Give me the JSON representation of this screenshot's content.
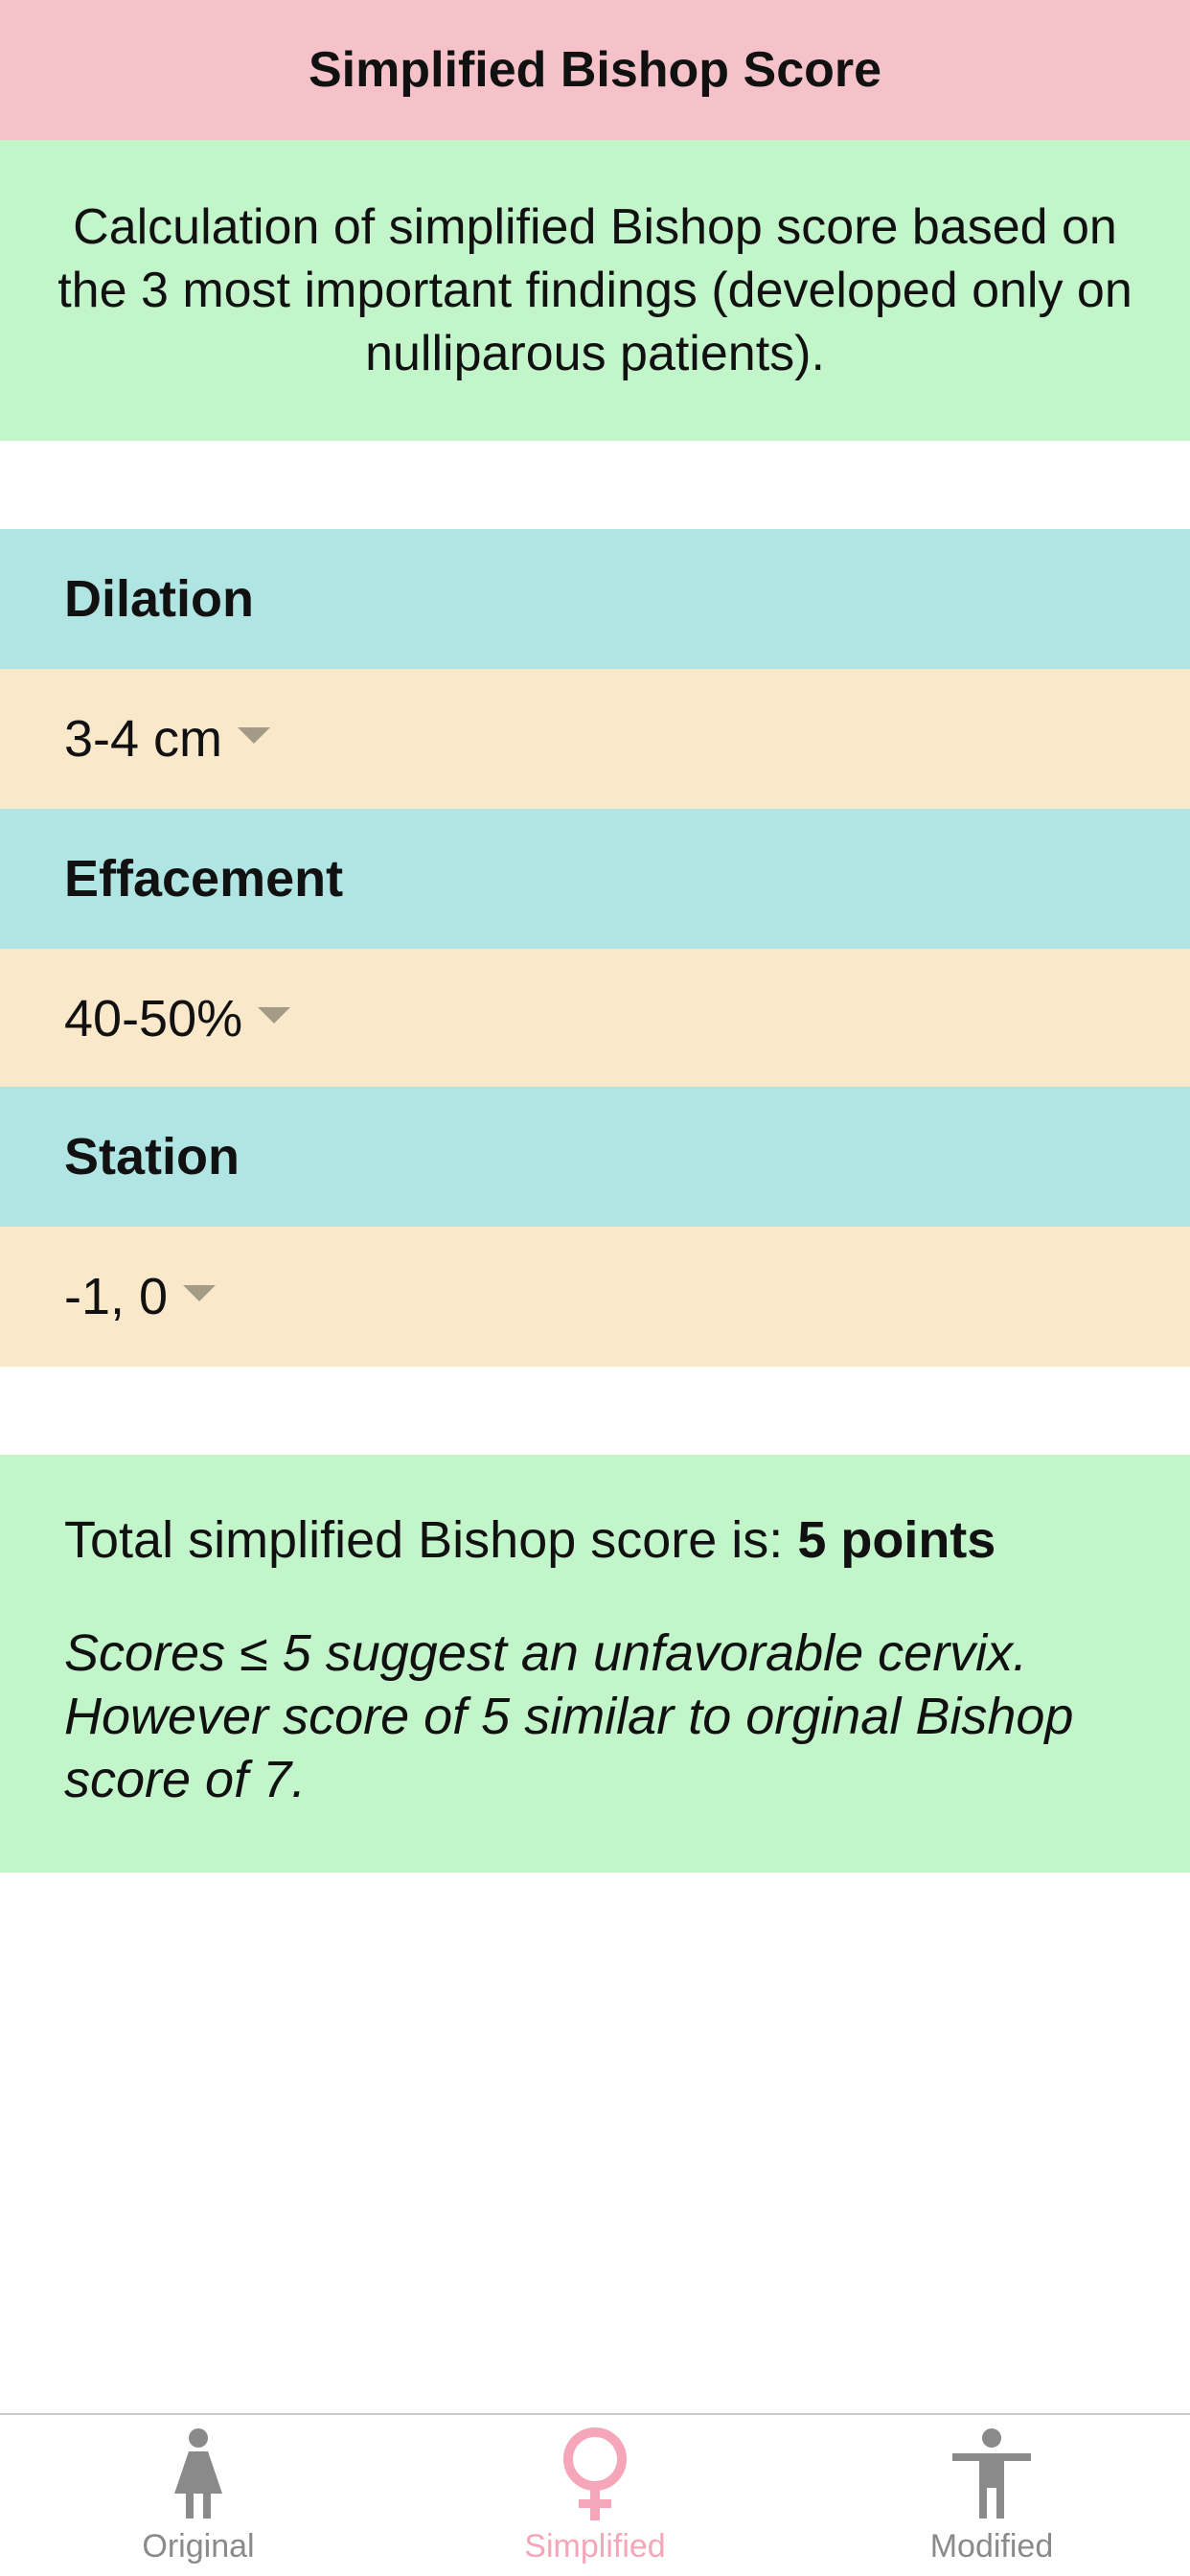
{
  "header": {
    "title": "Simplified Bishop Score"
  },
  "intro": {
    "text": "Calculation of simplified Bishop score based on the 3 most important findings (developed only on nulliparous patients)."
  },
  "fields": [
    {
      "label": "Dilation",
      "value": "3-4 cm"
    },
    {
      "label": "Effacement",
      "value": "40-50%"
    },
    {
      "label": "Station",
      "value": "-1, 0"
    }
  ],
  "result": {
    "prefix": "Total simplified Bishop score is: ",
    "score": "5 points",
    "note": "Scores ≤ 5 suggest an unfavorable cervix. However score of 5 similar to orginal Bishop score of 7."
  },
  "tabs": [
    {
      "label": "Original",
      "icon": "woman-figure-icon"
    },
    {
      "label": "Simplified",
      "icon": "female-symbol-icon",
      "active": true
    },
    {
      "label": "Modified",
      "icon": "person-figure-icon"
    }
  ],
  "colors": {
    "header_bg": "#f5c2ca",
    "intro_bg": "#c3f5cb",
    "label_bg": "#b0e5e4",
    "value_bg": "#fae8cb",
    "tab_active": "#f5a6b8",
    "tab_inactive": "#8a8a8a"
  }
}
